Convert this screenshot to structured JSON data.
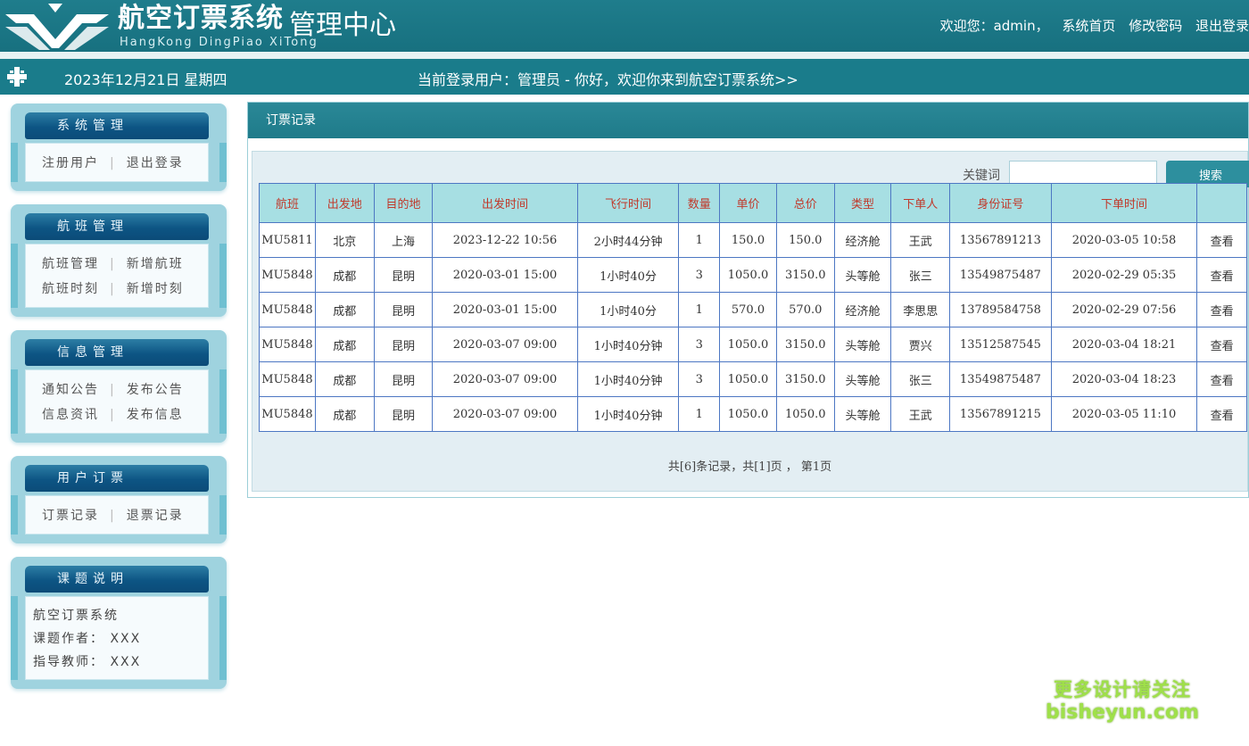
{
  "header": {
    "brand_cn": "航空订票系统",
    "brand_suffix": "管理中心",
    "brand_pinyin": "HangKong DingPiao XiTong",
    "welcome_user": "欢迎您：admin，",
    "nav_home": "系统首页",
    "nav_password": "修改密码",
    "nav_logout": "退出登录"
  },
  "infobar": {
    "date": "2023年12月21日 星期四",
    "welcome": "当前登录用户：管理员 - 你好，欢迎你来到航空订票系统>>"
  },
  "sidebar": {
    "system": {
      "title": "系统管理",
      "register": "注册用户",
      "logout": "退出登录"
    },
    "flight": {
      "title": "航班管理",
      "manage": "航班管理",
      "add": "新增航班",
      "schedule": "航班时刻",
      "add_schedule": "新增时刻"
    },
    "info": {
      "title": "信息管理",
      "notice": "通知公告",
      "publish_notice": "发布公告",
      "news": "信息资讯",
      "publish_info": "发布信息"
    },
    "booking": {
      "title": "用户订票",
      "records": "订票记录",
      "refunds": "退票记录"
    },
    "project": {
      "title": "课题说明",
      "line1": "航空订票系统",
      "line2": "课题作者：  XXX",
      "line3": "指导教师：  XXX"
    }
  },
  "main": {
    "title": "订票记录",
    "keyword_label": "关键词",
    "keyword_value": "",
    "search_label": "搜索",
    "columns": [
      "航班",
      "出发地",
      "目的地",
      "出发时间",
      "飞行时间",
      "数量",
      "单价",
      "总价",
      "类型",
      "下单人",
      "身份证号",
      "下单时间",
      ""
    ],
    "rows": [
      [
        "MU5811",
        "北京",
        "上海",
        "2023-12-22 10:56",
        "2小时44分钟",
        "1",
        "150.0",
        "150.0",
        "经济舱",
        "王武",
        "13567891213",
        "2020-03-05 10:58",
        "查看"
      ],
      [
        "MU5848",
        "成都",
        "昆明",
        "2020-03-01 15:00",
        "1小时40分",
        "3",
        "1050.0",
        "3150.0",
        "头等舱",
        "张三",
        "13549875487",
        "2020-02-29 05:35",
        "查看"
      ],
      [
        "MU5848",
        "成都",
        "昆明",
        "2020-03-01 15:00",
        "1小时40分",
        "1",
        "570.0",
        "570.0",
        "经济舱",
        "李思思",
        "13789584758",
        "2020-02-29 07:56",
        "查看"
      ],
      [
        "MU5848",
        "成都",
        "昆明",
        "2020-03-07 09:00",
        "1小时40分钟",
        "3",
        "1050.0",
        "3150.0",
        "头等舱",
        "贾兴",
        "13512587545",
        "2020-03-04 18:21",
        "查看"
      ],
      [
        "MU5848",
        "成都",
        "昆明",
        "2020-03-07 09:00",
        "1小时40分钟",
        "3",
        "1050.0",
        "3150.0",
        "头等舱",
        "张三",
        "13549875487",
        "2020-03-04 18:23",
        "查看"
      ],
      [
        "MU5848",
        "成都",
        "昆明",
        "2020-03-07 09:00",
        "1小时40分钟",
        "1",
        "1050.0",
        "1050.0",
        "头等舱",
        "王武",
        "13567891215",
        "2020-03-05 11:10",
        "查看"
      ]
    ],
    "pager": "共[6]条记录，共[1]页 ， 第1页"
  },
  "watermark": {
    "cn": "更多设计请关注",
    "en": "bisheyun.com"
  }
}
